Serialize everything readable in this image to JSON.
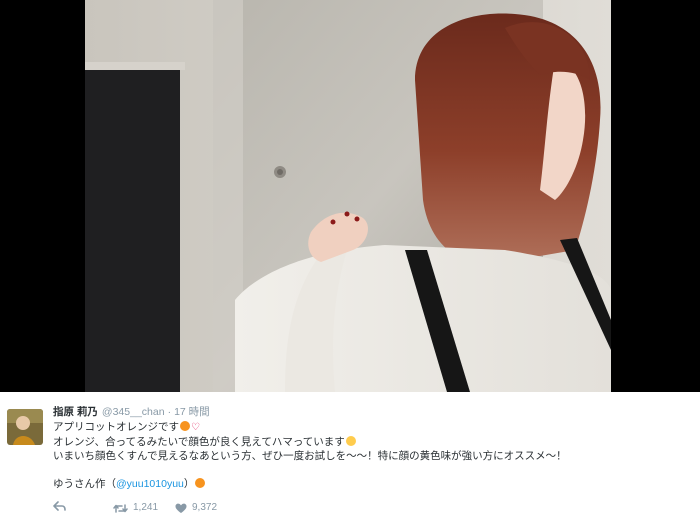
{
  "tweet": {
    "display_name": "指原 莉乃",
    "handle": "@345__chan",
    "separator": "·",
    "time": "17 時間",
    "line1": "アプリコットオレンジです",
    "line1_heart": "♡",
    "line2": "オレンジ、合ってるみたいで顔色が良く見えてハマっています",
    "line3": "いまいち顔色くすんで見えるなあという方、ぜひ一度お試しを〜〜！特に顔の黄色味が強い方にオススメ〜！",
    "line4_prefix": "ゆうさん作（",
    "mention": "@yuu1010yuu",
    "line4_suffix": "）",
    "retweet_count": "1,241",
    "like_count": "9,372"
  },
  "icons": {
    "reply": "reply-icon",
    "retweet": "retweet-icon",
    "like": "heart-icon",
    "orange": "orange-emoji-icon",
    "smile": "smiling-face-emoji-icon"
  },
  "colors": {
    "name": "#292f33",
    "meta": "#8899a6",
    "link": "#1b95e0",
    "orange": "#f7931e",
    "heart": "#e0245e"
  }
}
